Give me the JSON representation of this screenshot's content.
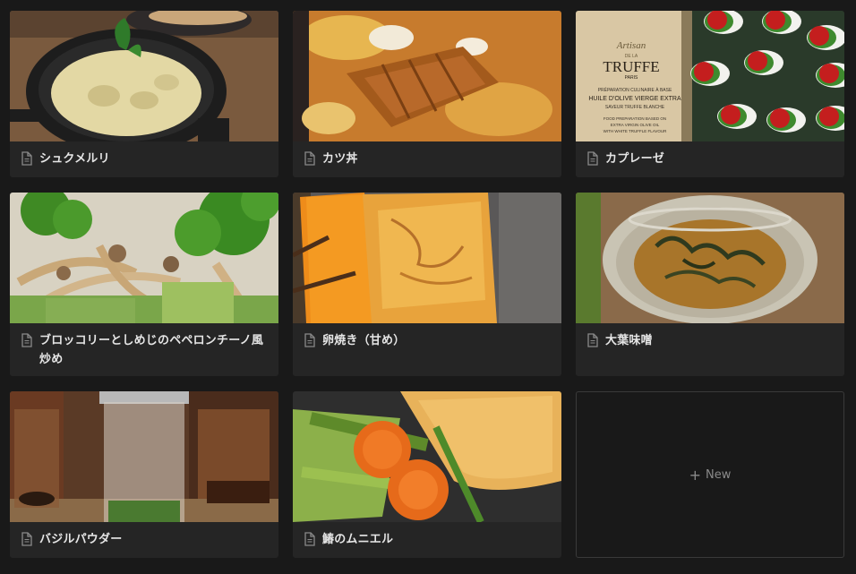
{
  "cards": [
    {
      "title": "シュクメルリ",
      "icon": "page-icon"
    },
    {
      "title": "カツ丼",
      "icon": "page-icon"
    },
    {
      "title": "カプレーゼ",
      "icon": "page-icon",
      "photo_text": {
        "brand_top": "Artisan",
        "brand_mid": "DE LA",
        "brand": "TRUFFE",
        "city": "PARIS",
        "line1": "PRÉPARATION CULINAIRE À BASE",
        "line2": "HUILE D'OLIVE VIERGE EXTRA",
        "line3": "SAVEUR TRUFFE BLANCHE",
        "line4": "FOOD PREPARATION BASED ON",
        "line5": "EXTRA VIRGIN OLIVE OIL",
        "line6": "WITH WHITE TRUFFLE FLAVOUR"
      }
    },
    {
      "title": "ブロッコリーとしめじのペペロンチーノ風炒め",
      "icon": "page-icon"
    },
    {
      "title": "卵焼き（甘め）",
      "icon": "page-icon"
    },
    {
      "title": "大葉味噌",
      "icon": "page-icon"
    },
    {
      "title": "バジルパウダー",
      "icon": "page-icon"
    },
    {
      "title": "鰆のムニエル",
      "icon": "page-icon"
    }
  ],
  "new_button": {
    "label": "New",
    "icon": "plus-icon"
  },
  "colors": {
    "background": "#191919",
    "card": "#252525",
    "text": "#e6e6e6",
    "muted": "#8a8a8a"
  }
}
